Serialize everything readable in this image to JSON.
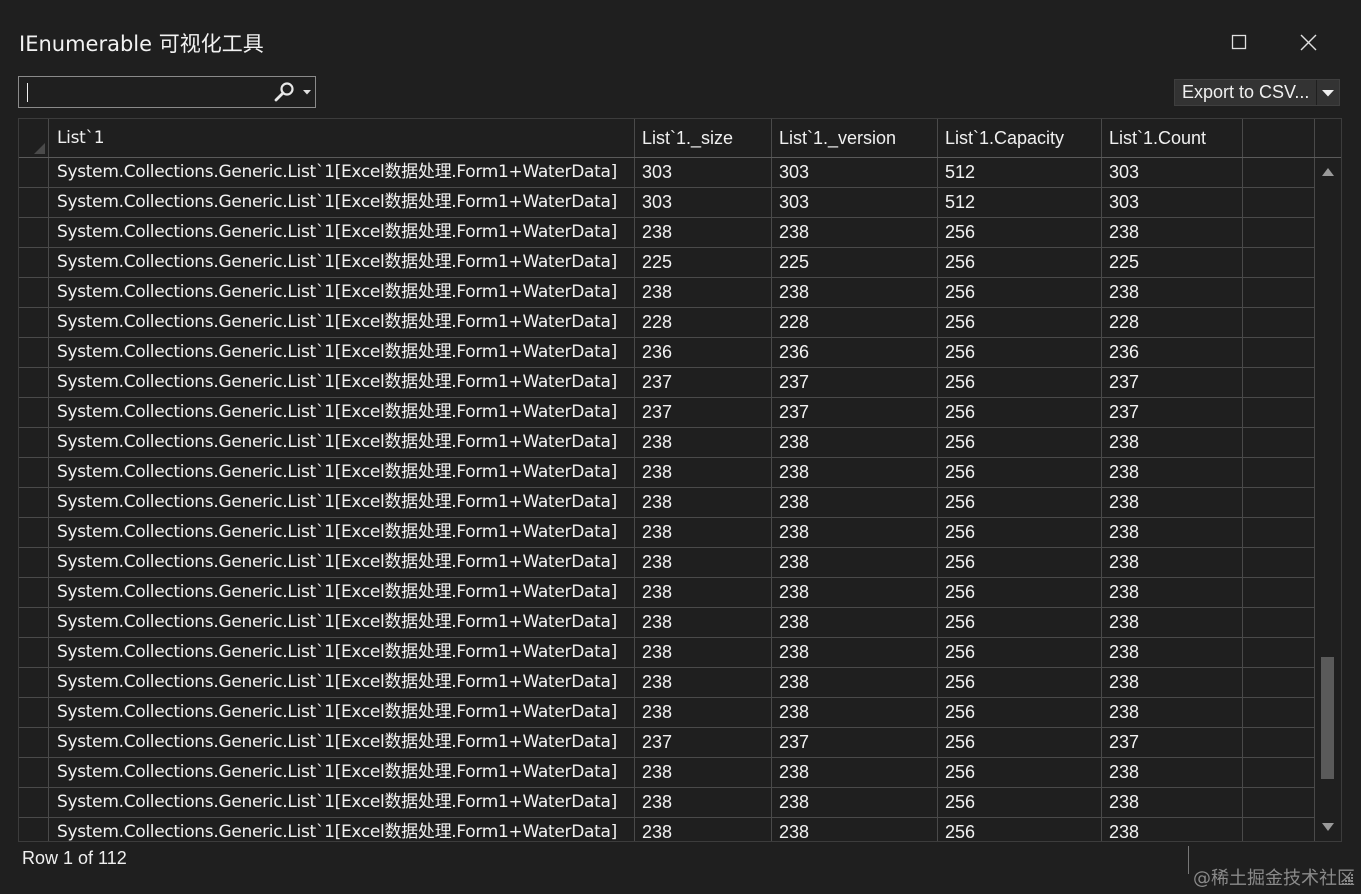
{
  "window": {
    "title": "IEnumerable 可视化工具"
  },
  "search": {
    "value": "",
    "placeholder": ""
  },
  "toolbar": {
    "export_label": "Export to CSV..."
  },
  "table": {
    "columns": [
      "List`1",
      "List`1._size",
      "List`1._version",
      "List`1.Capacity",
      "List`1.Count",
      ""
    ],
    "rows": [
      [
        "System.Collections.Generic.List`1[Excel数据处理.Form1+WaterData]",
        "303",
        "303",
        "512",
        "303",
        ""
      ],
      [
        "System.Collections.Generic.List`1[Excel数据处理.Form1+WaterData]",
        "303",
        "303",
        "512",
        "303",
        ""
      ],
      [
        "System.Collections.Generic.List`1[Excel数据处理.Form1+WaterData]",
        "238",
        "238",
        "256",
        "238",
        ""
      ],
      [
        "System.Collections.Generic.List`1[Excel数据处理.Form1+WaterData]",
        "225",
        "225",
        "256",
        "225",
        ""
      ],
      [
        "System.Collections.Generic.List`1[Excel数据处理.Form1+WaterData]",
        "238",
        "238",
        "256",
        "238",
        ""
      ],
      [
        "System.Collections.Generic.List`1[Excel数据处理.Form1+WaterData]",
        "228",
        "228",
        "256",
        "228",
        ""
      ],
      [
        "System.Collections.Generic.List`1[Excel数据处理.Form1+WaterData]",
        "236",
        "236",
        "256",
        "236",
        ""
      ],
      [
        "System.Collections.Generic.List`1[Excel数据处理.Form1+WaterData]",
        "237",
        "237",
        "256",
        "237",
        ""
      ],
      [
        "System.Collections.Generic.List`1[Excel数据处理.Form1+WaterData]",
        "237",
        "237",
        "256",
        "237",
        ""
      ],
      [
        "System.Collections.Generic.List`1[Excel数据处理.Form1+WaterData]",
        "238",
        "238",
        "256",
        "238",
        ""
      ],
      [
        "System.Collections.Generic.List`1[Excel数据处理.Form1+WaterData]",
        "238",
        "238",
        "256",
        "238",
        ""
      ],
      [
        "System.Collections.Generic.List`1[Excel数据处理.Form1+WaterData]",
        "238",
        "238",
        "256",
        "238",
        ""
      ],
      [
        "System.Collections.Generic.List`1[Excel数据处理.Form1+WaterData]",
        "238",
        "238",
        "256",
        "238",
        ""
      ],
      [
        "System.Collections.Generic.List`1[Excel数据处理.Form1+WaterData]",
        "238",
        "238",
        "256",
        "238",
        ""
      ],
      [
        "System.Collections.Generic.List`1[Excel数据处理.Form1+WaterData]",
        "238",
        "238",
        "256",
        "238",
        ""
      ],
      [
        "System.Collections.Generic.List`1[Excel数据处理.Form1+WaterData]",
        "238",
        "238",
        "256",
        "238",
        ""
      ],
      [
        "System.Collections.Generic.List`1[Excel数据处理.Form1+WaterData]",
        "238",
        "238",
        "256",
        "238",
        ""
      ],
      [
        "System.Collections.Generic.List`1[Excel数据处理.Form1+WaterData]",
        "238",
        "238",
        "256",
        "238",
        ""
      ],
      [
        "System.Collections.Generic.List`1[Excel数据处理.Form1+WaterData]",
        "238",
        "238",
        "256",
        "238",
        ""
      ],
      [
        "System.Collections.Generic.List`1[Excel数据处理.Form1+WaterData]",
        "237",
        "237",
        "256",
        "237",
        ""
      ],
      [
        "System.Collections.Generic.List`1[Excel数据处理.Form1+WaterData]",
        "238",
        "238",
        "256",
        "238",
        ""
      ],
      [
        "System.Collections.Generic.List`1[Excel数据处理.Form1+WaterData]",
        "238",
        "238",
        "256",
        "238",
        ""
      ],
      [
        "System.Collections.Generic.List`1[Excel数据处理.Form1+WaterData]",
        "238",
        "238",
        "256",
        "238",
        ""
      ]
    ]
  },
  "status": {
    "text": "Row 1 of 112"
  },
  "watermark": "@稀土掘金技术社区",
  "icons": {
    "maximize": "maximize-icon",
    "close": "close-icon",
    "search": "search-icon",
    "dropdown": "chevron-down-icon",
    "scroll_up": "scroll-up-arrow-icon",
    "scroll_down": "scroll-down-arrow-icon",
    "resize": "resize-grip-icon"
  },
  "colors": {
    "background": "#1f1f1f",
    "gridline": "#4a4a4a",
    "text": "#f0f0f0",
    "button": "#333333",
    "scroll_thumb": "#5a5a5a"
  }
}
